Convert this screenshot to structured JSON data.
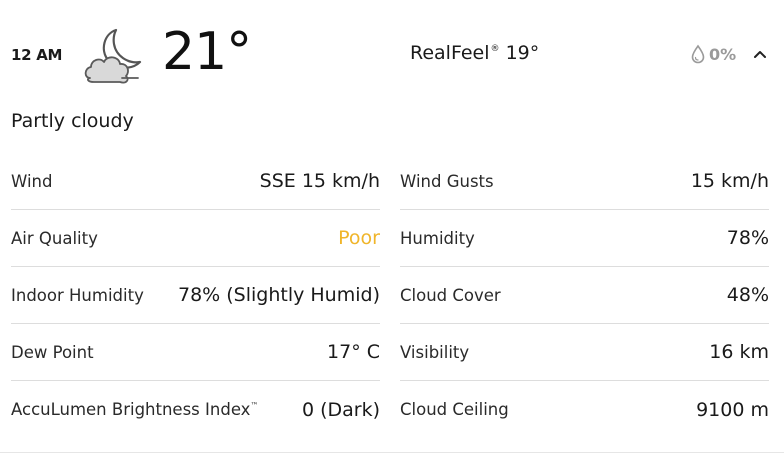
{
  "header": {
    "time": "12 AM",
    "icon": "partly-cloudy-night-icon",
    "temperature": "21°",
    "realfeel_label": "RealFeel",
    "realfeel_mark": "®",
    "realfeel_value": "19°",
    "precip_icon": "raindrop-icon",
    "precip_value": "0%",
    "toggle_icon": "chevron-up-icon"
  },
  "phrase": "Partly cloudy",
  "details_left": [
    {
      "label": "Wind",
      "value": "SSE 15 km/h"
    },
    {
      "label": "Air Quality",
      "value": "Poor"
    },
    {
      "label": "Indoor Humidity",
      "value": "78% (Slightly Humid)"
    },
    {
      "label": "Dew Point",
      "value": "17° C"
    },
    {
      "label": "AccuLumen Brightness Index",
      "label_mark": "™",
      "value": "0 (Dark)"
    }
  ],
  "details_right": [
    {
      "label": "Wind Gusts",
      "value": "15 km/h"
    },
    {
      "label": "Humidity",
      "value": "78%"
    },
    {
      "label": "Cloud Cover",
      "value": "48%"
    },
    {
      "label": "Visibility",
      "value": "16 km"
    },
    {
      "label": "Cloud Ceiling",
      "value": "9100 m"
    }
  ],
  "colors": {
    "air_quality_poor": "#f0b52a",
    "muted": "#9a9a9a",
    "divider": "#dddddd"
  }
}
